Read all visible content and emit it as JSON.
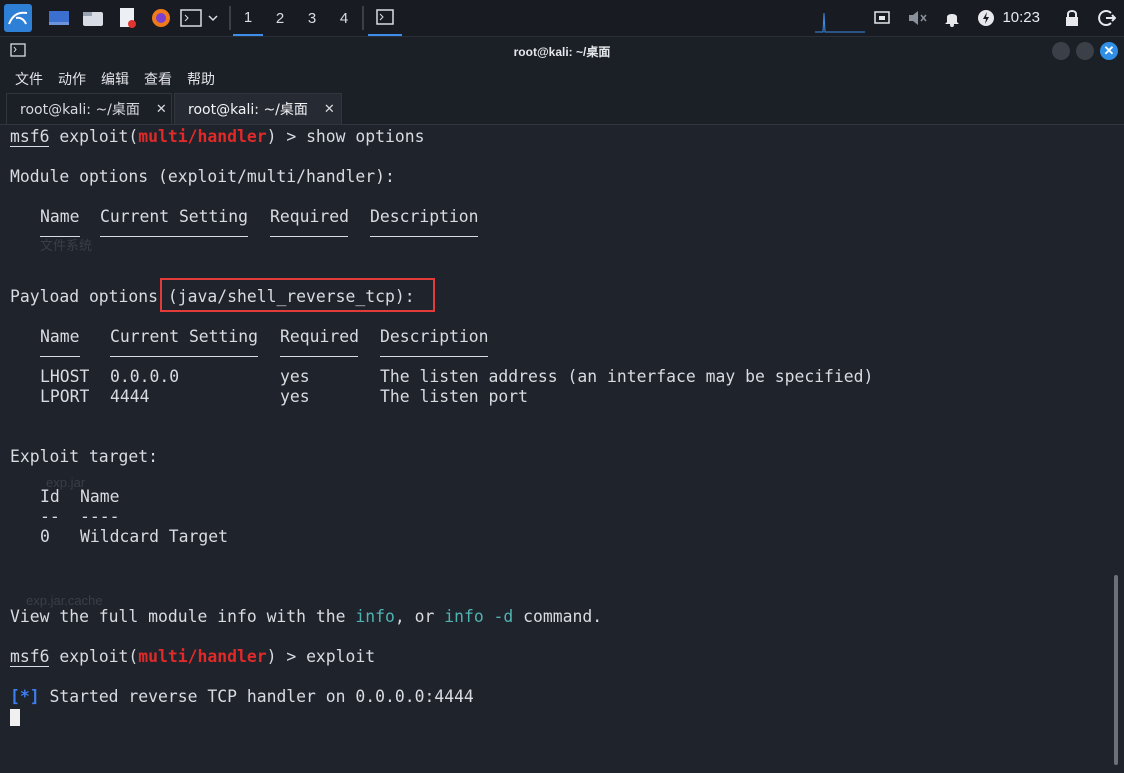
{
  "panel": {
    "workspaces": [
      "1",
      "2",
      "3",
      "4"
    ],
    "clock": "10:23"
  },
  "window": {
    "title": "root@kali: ~/桌面",
    "close_glyph": "✕"
  },
  "menu": [
    "文件",
    "动作",
    "编辑",
    "查看",
    "帮助"
  ],
  "tabs": [
    {
      "label": "root@kali: ~/桌面",
      "close": "✕"
    },
    {
      "label": "root@kali: ~/桌面",
      "close": "✕"
    }
  ],
  "terminal": {
    "prompt1": {
      "msf": "msf6",
      "pre": " exploit(",
      "module": "multi/handler",
      "post": ") > show options"
    },
    "module_options": "Module options (exploit/multi/handler):",
    "mod_headers": {
      "name": "Name",
      "setting": "Current Setting",
      "required": "Required",
      "description": "Description"
    },
    "payload_prefix": "Payload options ",
    "payload_name": "(java/shell_reverse_tcp):",
    "pay_headers": {
      "name": "Name",
      "setting": "Current Setting",
      "required": "Required",
      "description": "Description"
    },
    "rows": [
      {
        "name": "LHOST",
        "setting": "0.0.0.0",
        "required": "yes",
        "description": "The listen address (an interface may be specified)"
      },
      {
        "name": "LPORT",
        "setting": "4444",
        "required": "yes",
        "description": "The listen port"
      }
    ],
    "exploit_target": "Exploit target:",
    "target_headers": {
      "id": "Id",
      "name": "Name"
    },
    "target_dashes": {
      "id": "--",
      "name": "----"
    },
    "target_row": {
      "id": "0",
      "name": "Wildcard Target"
    },
    "info_line": {
      "a": "View the full module info with the ",
      "b": "info",
      "c": ", or ",
      "d": "info -d",
      "e": " command."
    },
    "prompt2": {
      "msf": "msf6",
      "pre": " exploit(",
      "module": "multi/handler",
      "post": ") > exploit"
    },
    "status": {
      "marker": "[*]",
      "text": " Started reverse TCP handler on 0.0.0.0:4444"
    }
  }
}
